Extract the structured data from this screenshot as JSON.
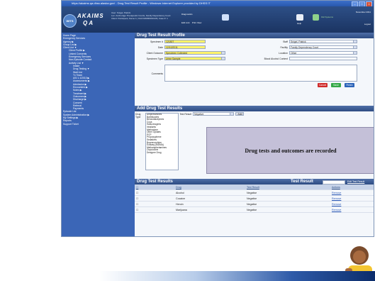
{
  "browser": {
    "title": "https://akaims.qa.dhss.alaska.gov/ - Drug Test Result Profile - Windows Internet Explorer provided by DHSS IT"
  },
  "header": {
    "logo_text": "WITS",
    "brand": "AKAIMS",
    "env": "QA",
    "user_lines": [
      "User:   Snigel, Patrick",
      "Loc:    Anchorage Therapeutic Courts, Family Dependency Court",
      "Client: Participant, Name 1 | FACV2008F000148 | Case #: 1"
    ],
    "diagnostics": "Diagnostics",
    "edit_link": "Edit Link",
    "print_view": "Print View",
    "help": "Help",
    "date": "November 2011",
    "logout": "Logout",
    "brand_secondary": "FEI Systems"
  },
  "sidebar": [
    "Home Page",
    "Emergency Services",
    "Agency ▶",
    "Group List ▶",
    "Client List ▼",
    "Client Profile ▶",
    "Linked Consents",
    "Emergency Services",
    "Non-Episode Contact",
    "Activity List ▼",
    "Intake",
    "Drug Testing ▼",
    "Wait List",
    "Tx Team",
    "ASI 1.1/2010 ▶",
    "Assessments ▶",
    "Admission ▶",
    "Encounters ▶",
    "Notes ▶",
    "Treatment ▶",
    "Outcomes ▶",
    "Discharge ▶",
    "Consent",
    "Referral",
    "Payments",
    "Episode List",
    "System Administration ▶",
    "My Settings ▶",
    "Reports",
    "Support Ticket"
  ],
  "profile": {
    "title": "Drug Test Result Profile",
    "specimen_label": "Specimen #",
    "specimen_value": "121807",
    "date_label": "Date",
    "date_value": "12/10/2011",
    "outcome_label": "Client Outcome",
    "outcome_value": "Specimen Collected",
    "type_label": "Specimen Type",
    "type_value": "Urine Sample",
    "staff_label": "Staff",
    "staff_value": "Snigel, Patrick",
    "facility_label": "Facility",
    "facility_value": "Family Dependency Court",
    "location_label": "Location",
    "location_value": "Other",
    "bac_label": "Blood Alcohol Content",
    "comments_label": "Comments",
    "cancel": "Cancel",
    "save": "Save",
    "finish": "Finish"
  },
  "add_results": {
    "title": "Add Drug Test Results",
    "drug_type_label": "Drug Type",
    "drugs": [
      "Amphetamines",
      "Barbiturates",
      "Benzodiazepines",
      "Coca",
      "Hallucinogens",
      "Inhalants",
      "Methadone",
      "Other Opiates",
      "PCP",
      "Propoxyphene",
      "Sedatives",
      "Buprenorphine",
      "Ecstasy (MDMA)",
      "Methamphetamines",
      "Oxycodone",
      "Designer Drug"
    ],
    "test_result_label": "Test Result",
    "test_result_value": "Negative",
    "add": "Add",
    "message": "Drug tests and outcomes are recorded"
  },
  "results": {
    "title": "Drug Test Results",
    "test_result_label": "Test Result",
    "edit_link": "Edit Test Result",
    "columns": [
      "Drug",
      "Test Result",
      "Actions"
    ],
    "rows": [
      {
        "drug": "Alcohol",
        "result": "Negative",
        "action": "Remove"
      },
      {
        "drug": "Cocaine",
        "result": "Negative",
        "action": "Remove"
      },
      {
        "drug": "Heroin",
        "result": "Negative",
        "action": "Remove"
      },
      {
        "drug": "Marijuana",
        "result": "Negative",
        "action": "Remove"
      }
    ]
  },
  "colors": {
    "header": "#1b3462",
    "sidebar": "#3b66b7",
    "required_field": "#fff36a",
    "cancel": "#d02a2a",
    "save": "#34a848",
    "finish": "#2b63b8"
  }
}
